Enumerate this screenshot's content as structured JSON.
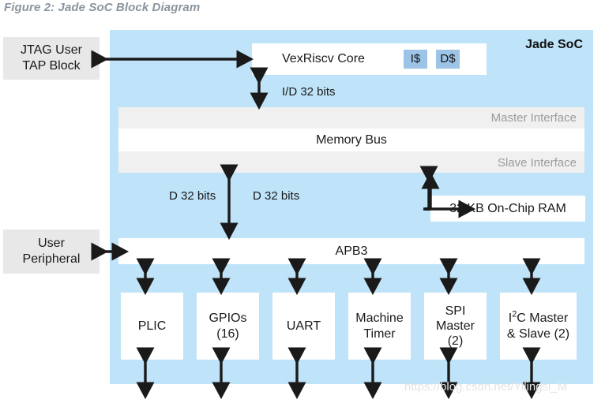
{
  "figure": {
    "title": "Figure 2: Jade SoC Block Diagram"
  },
  "soc": {
    "label": "Jade SoC",
    "background_color": "#bfe3f8"
  },
  "external_blocks": [
    {
      "id": "jtag",
      "lines": [
        "JTAG User",
        "TAP Block"
      ]
    },
    {
      "id": "user-peripheral",
      "lines": [
        "User",
        "Peripheral"
      ]
    }
  ],
  "core": {
    "label": "VexRiscv Core",
    "caches": [
      {
        "id": "icache",
        "label": "I$"
      },
      {
        "id": "dcache",
        "label": "D$"
      }
    ],
    "cache_color": "#9dc3e6"
  },
  "bus": {
    "master_interface": "Master Interface",
    "center_label": "Memory Bus",
    "slave_interface": "Slave Interface",
    "band_color": "#f0f0f0"
  },
  "ram": {
    "label": "32 KB On-Chip RAM"
  },
  "apb3": {
    "label": "APB3"
  },
  "connections": [
    {
      "id": "core-to-bus",
      "label": "I/D 32 bits"
    },
    {
      "id": "bus-to-apb3",
      "label": "D 32 bits"
    },
    {
      "id": "bus-to-ram",
      "label": "D 32 bits"
    }
  ],
  "peripherals": [
    {
      "id": "plic",
      "lines": [
        "PLIC"
      ]
    },
    {
      "id": "gpios",
      "lines": [
        "GPIOs",
        "(16)"
      ]
    },
    {
      "id": "uart",
      "lines": [
        "UART"
      ]
    },
    {
      "id": "machine-timer",
      "lines": [
        "Machine",
        "Timer"
      ]
    },
    {
      "id": "spi-master",
      "lines": [
        "SPI",
        "Master",
        "(2)"
      ]
    },
    {
      "id": "i2c",
      "lines": [
        "I2C Master",
        "& Slave (2)"
      ]
    }
  ],
  "watermark": {
    "text": "https://blog.csdn.net/Yilingsi_M"
  }
}
